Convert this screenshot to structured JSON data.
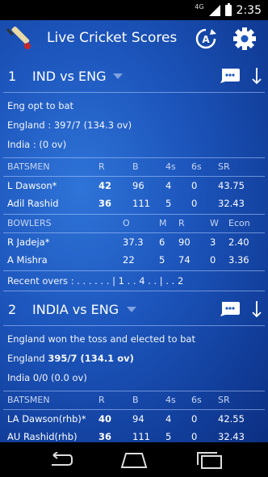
{
  "status_bar": {
    "network": "4G",
    "time": "2:35"
  },
  "app_bar": {
    "title": "Live Cricket Scores",
    "logo_icon": "cricket-bat-icon",
    "refresh_icon": "auto-refresh-icon",
    "settings_icon": "gear-icon"
  },
  "matches": [
    {
      "number": "1",
      "title": "IND vs ENG",
      "toss": "Eng opt to bat",
      "team1_score": "England : 397/7 (134.3 ov)",
      "team2_score": "India : (0 ov)",
      "batsmen_header": [
        "BATSMEN",
        "R",
        "B",
        "4s",
        "6s",
        "SR"
      ],
      "batsmen": [
        [
          "L Dawson*",
          "42",
          "96",
          "4",
          "0",
          "43.75"
        ],
        [
          "Adil Rashid",
          "36",
          "111",
          "5",
          "0",
          "32.43"
        ]
      ],
      "bowlers_header": [
        "BOWLERS",
        "O",
        "M",
        "R",
        "W",
        "Econ"
      ],
      "bowlers": [
        [
          "R Jadeja*",
          "37.3",
          "6",
          "90",
          "3",
          "2.40"
        ],
        [
          "A Mishra",
          "22",
          "5",
          "74",
          "0",
          "3.36"
        ]
      ],
      "recent_overs": "Recent overs : . . . . . . | 1 . . 4 . . | . . 2"
    },
    {
      "number": "2",
      "title": "INDIA vs ENG",
      "toss": "England won the toss and elected to bat",
      "team1_name": "England",
      "team1_score": "395/7 (134.1 ov)",
      "team2_score": "India 0/0 (0.0 ov)",
      "batsmen_header": [
        "BATSMEN",
        "R",
        "B",
        "4s",
        "6s",
        "SR"
      ],
      "batsmen": [
        [
          "LA Dawson(rhb)*",
          "40",
          "94",
          "4",
          "0",
          "42.55"
        ],
        [
          "AU Rashid(rhb)",
          "36",
          "111",
          "5",
          "0",
          "32.43"
        ]
      ]
    }
  ],
  "nav_bar": {
    "back_icon": "back-icon",
    "home_icon": "home-icon",
    "recents_icon": "recents-icon"
  }
}
